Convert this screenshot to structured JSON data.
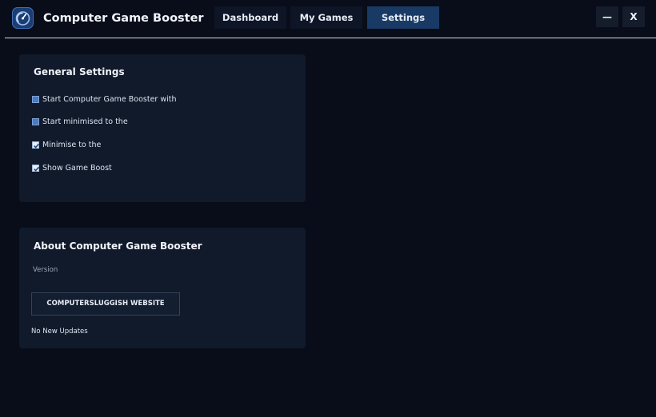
{
  "app": {
    "title": "Computer Game Booster"
  },
  "tabs": [
    {
      "label": "Dashboard",
      "active": false
    },
    {
      "label": "My Games",
      "active": false
    },
    {
      "label": "Settings",
      "active": true
    }
  ],
  "window_controls": {
    "minimize_label": "—",
    "close_label": "X"
  },
  "general_settings": {
    "title": "General Settings",
    "options": [
      {
        "label": "Start Computer Game Booster with",
        "checked": false
      },
      {
        "label": "Start minimised to the",
        "checked": false
      },
      {
        "label": "Minimise to the",
        "checked": true
      },
      {
        "label": "Show Game Boost",
        "checked": true
      }
    ]
  },
  "about": {
    "title": "About Computer Game Booster",
    "version_label": "Version",
    "website_button_label": "COMPUTERSLUGGISH WEBSITE",
    "update_status": "No New Updates"
  },
  "colors": {
    "background": "#080d19",
    "panel": "#111a2b",
    "active_tab": "#1a3a66",
    "checkbox_unchecked": "#4f79b8"
  },
  "icons": {
    "logo": "speedometer-icon",
    "checked": "checkmark-icon"
  }
}
